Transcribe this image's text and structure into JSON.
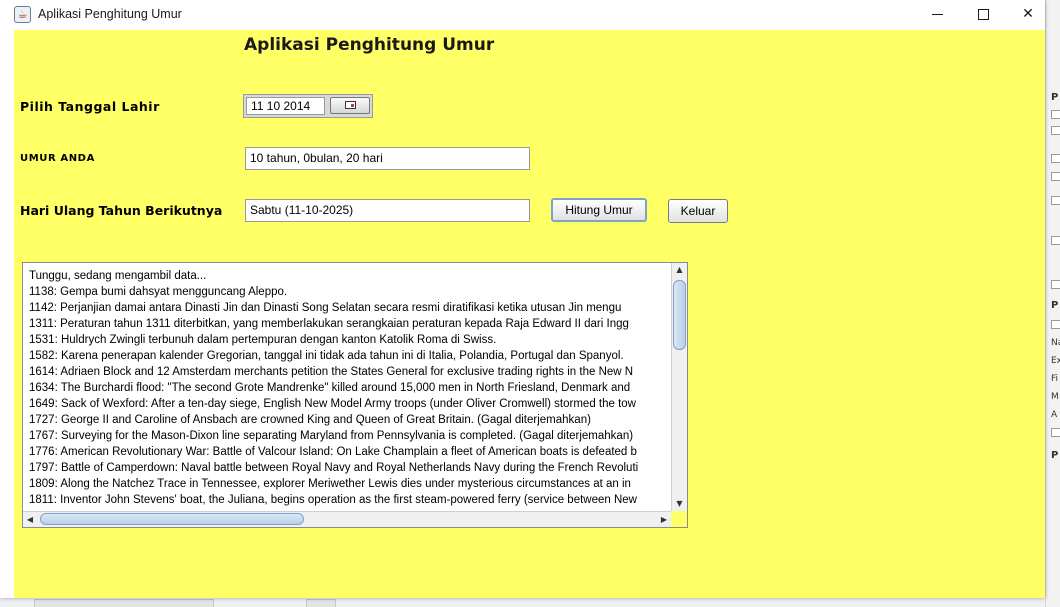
{
  "window": {
    "title": "Aplikasi Penghitung Umur",
    "controls": {
      "minimize": "minimize",
      "maximize": "maximize",
      "close": "✕"
    }
  },
  "colors": {
    "background": "#ffff66"
  },
  "form": {
    "heading": "Aplikasi Penghitung Umur",
    "birth_label": "Pilih Tanggal Lahir",
    "birth_date_value": "11 10 2014",
    "age_label": "UMUR ANDA",
    "age_value": "10 tahun, 0bulan, 20 hari",
    "next_birthday_label": "Hari Ulang Tahun Berikutnya",
    "next_birthday_value": "Sabtu (11-10-2025)",
    "calculate_button": "Hitung Umur",
    "exit_button": "Keluar"
  },
  "history_lines": [
    "Tunggu, sedang mengambil data...",
    "1138: Gempa bumi dahsyat mengguncang Aleppo.",
    "1142: Perjanjian damai antara Dinasti Jin dan Dinasti Song Selatan secara resmi diratifikasi ketika utusan Jin mengu",
    "1311: Peraturan tahun 1311 diterbitkan, yang memberlakukan serangkaian peraturan kepada Raja Edward II dari Ingg",
    "1531: Huldrych Zwingli terbunuh dalam pertempuran dengan kanton Katolik Roma di Swiss.",
    "1582: Karena penerapan kalender Gregorian, tanggal ini tidak ada tahun ini di Italia, Polandia, Portugal dan Spanyol.",
    "1614: Adriaen Block and 12 Amsterdam merchants petition the States General for exclusive trading rights in the New N",
    "1634: The Burchardi flood: \"The second Grote Mandrenke\" killed around 15,000 men in North Friesland, Denmark and",
    "1649: Sack of Wexford: After a ten-day siege, English New Model Army troops (under Oliver Cromwell) stormed the tow",
    "1727: George II and Caroline of Ansbach are crowned King and Queen of Great Britain. (Gagal diterjemahkan)",
    "1767: Surveying for the Mason-Dixon line separating Maryland from Pennsylvania is completed. (Gagal diterjemahkan)",
    "1776: American Revolutionary War: Battle of Valcour Island: On Lake Champlain a fleet of American boats is defeated b",
    "1797: Battle of Camperdown: Naval battle between Royal Navy and Royal Netherlands Navy during the French Revoluti",
    "1809: Along the Natchez Trace in Tennessee, explorer Meriwether Lewis dies under mysterious circumstances at an in",
    "1811: Inventor John Stevens' boat, the Juliana, begins operation as the first steam-powered ferry (service between New"
  ],
  "background_ide": {
    "fragments": [
      "P",
      "Na",
      "Ex",
      "Fi",
      "M",
      "A",
      "P",
      "P"
    ]
  }
}
